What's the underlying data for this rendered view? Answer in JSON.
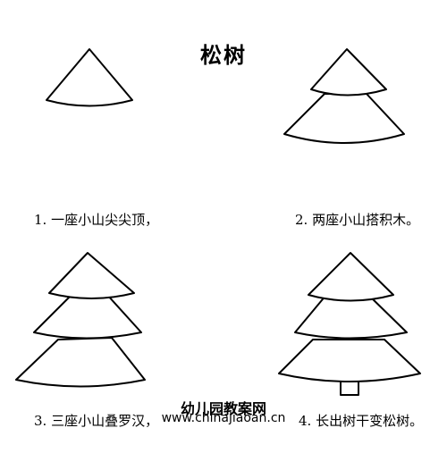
{
  "title": "松树",
  "steps": [
    {
      "label": "1. 一座小山尖尖顶，"
    },
    {
      "label": "2. 两座小山搭积木。"
    },
    {
      "label": "3. 三座小山叠罗汉，"
    },
    {
      "label": "4. 长出树干变松树。"
    }
  ],
  "watermark": {
    "name": "幼儿园教案网",
    "url": "www.chinajiaoan.cn"
  }
}
